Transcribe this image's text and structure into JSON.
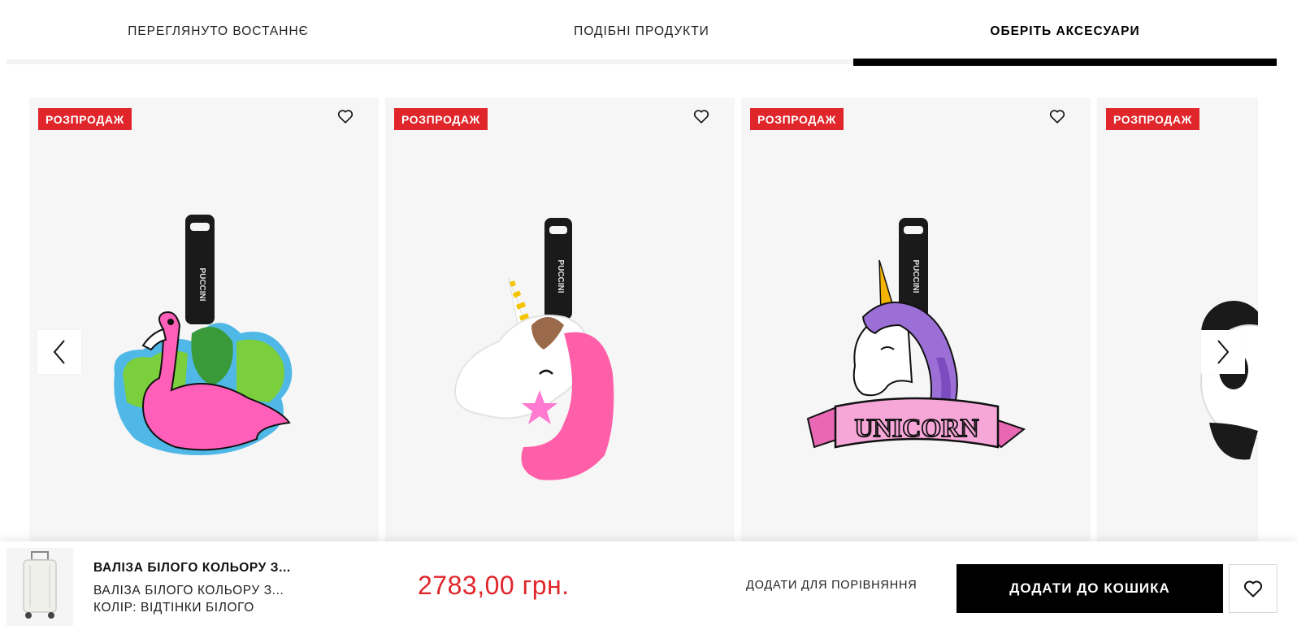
{
  "tabs": [
    {
      "label": "ПЕРЕГЛЯНУТО ВОСТАННЄ"
    },
    {
      "label": "ПОДІБНІ ПРОДУКТИ"
    },
    {
      "label": "ОБЕРІТЬ АКСЕСУАРИ",
      "active": true
    }
  ],
  "carousel": {
    "badge_color": "#e0262b",
    "products": [
      {
        "badge": "РОЗПРОДАЖ",
        "image": "flamingo-luggage-tag",
        "strap_text": "PUCCINI"
      },
      {
        "badge": "РОЗПРОДАЖ",
        "image": "unicorn-head-luggage-tag",
        "strap_text": "PUCCINI"
      },
      {
        "badge": "РОЗПРОДАЖ",
        "image": "unicorn-banner-luggage-tag",
        "strap_text": "PUCCINI",
        "banner_text": "UNICORN"
      },
      {
        "badge": "РОЗПРОДАЖ",
        "image": "panda-luggage-tag"
      }
    ],
    "prev_icon": "chevron-left-icon",
    "next_icon": "chevron-right-icon"
  },
  "sticky_bar": {
    "product_name": "ВАЛІЗА БІЛОГО КОЛЬОРУ З...",
    "product_subtitle": "ВАЛІЗА БІЛОГО КОЛЬОРУ З...",
    "color": "КОЛІР: ВІДТІНКИ БІЛОГО",
    "price": "2783,00 грн.",
    "compare_label": "ДОДАТИ ДЛЯ ПОРІВНЯННЯ",
    "cart_label": "ДОДАТИ ДО КОШИКА",
    "price_color": "#e0262b"
  }
}
